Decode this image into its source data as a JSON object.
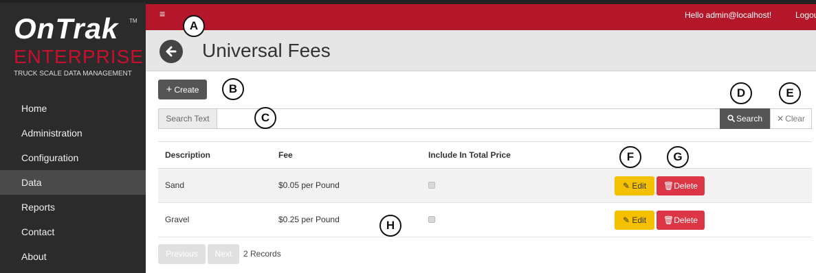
{
  "logo": {
    "brand": "OnTrak",
    "tm": "TM",
    "line2": "ENTERPRISE",
    "tagline": "TRUCK SCALE DATA MANAGEMENT"
  },
  "nav": [
    "Home",
    "Administration",
    "Configuration",
    "Data",
    "Reports",
    "Contact",
    "About"
  ],
  "nav_active": "Data",
  "topbar": {
    "menu_icon": "≡",
    "greeting": "Hello admin@localhost!",
    "logout": "Logout"
  },
  "header": {
    "title": "Universal Fees"
  },
  "toolbar": {
    "create_label": "Create"
  },
  "search": {
    "addon": "Search Text",
    "value": "",
    "search_label": "Search",
    "clear_label": "Clear"
  },
  "table": {
    "columns": [
      "Description",
      "Fee",
      "Include In Total Price"
    ],
    "rows": [
      {
        "description": "Sand",
        "fee": "$0.05 per Pound",
        "include": true
      },
      {
        "description": "Gravel",
        "fee": "$0.25 per Pound",
        "include": true
      }
    ],
    "edit_label": "Edit",
    "delete_label": "Delete"
  },
  "pagination": {
    "prev": "Previous",
    "next": "Next",
    "count": "2 Records"
  },
  "callouts": [
    "A",
    "B",
    "C",
    "D",
    "E",
    "F",
    "G",
    "H"
  ],
  "colors": {
    "topbar": "#b5172a",
    "sidebar": "#2b2b2b",
    "edit": "#f5c000",
    "delete": "#dc3545",
    "brand_red": "#c8102e"
  }
}
